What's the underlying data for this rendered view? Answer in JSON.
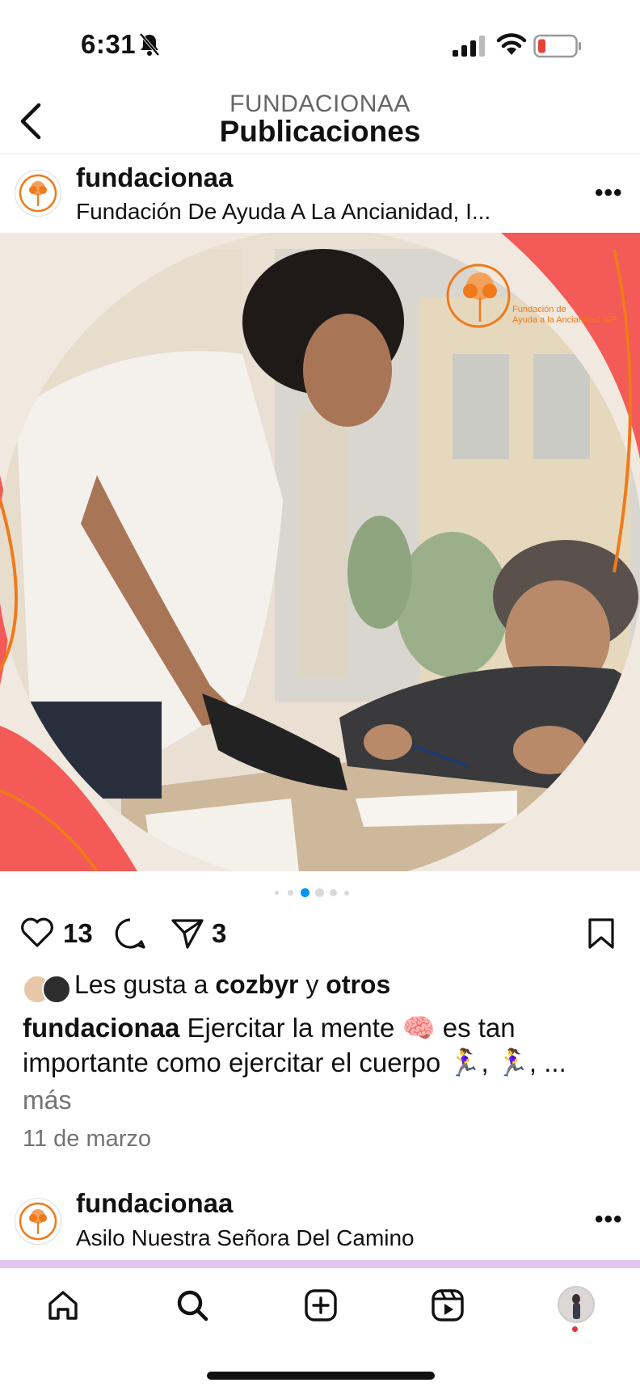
{
  "status_bar": {
    "time": "6:31",
    "icons": [
      "bell-slash-icon",
      "signal-icon",
      "wifi-icon",
      "battery-low-icon"
    ],
    "battery_color": "#e8413c"
  },
  "header": {
    "subtitle": "FUNDACIONAA",
    "title": "Publicaciones"
  },
  "post": {
    "username": "fundacionaa",
    "location": "Fundación De Ayuda A La Ancianidad, I...",
    "image_logo_line1": "Fundación de",
    "image_logo_line2": "Ayuda a la Ancianidad IAP",
    "carousel": {
      "total": 6,
      "active_index": 2
    },
    "likes_count": "13",
    "shares_count": "3",
    "likes_prefix": "Les gusta a",
    "likes_user": "cozbyr",
    "likes_conj": "y",
    "likes_others": "otros",
    "caption_user": "fundacionaa",
    "caption_text": "Ejercitar la mente 🧠 es tan importante como ejercitar el cuerpo 🏃‍♀️, 🏃‍♀️, ...",
    "more_label": "más",
    "date": "11 de marzo"
  },
  "next_post": {
    "username": "fundacionaa",
    "location": "Asilo Nuestra Señora Del Camino"
  },
  "tab_bar": {
    "items": [
      "home-icon",
      "search-icon",
      "create-icon",
      "reels-icon",
      "profile-avatar"
    ],
    "notification_dot_color": "#e8313c"
  },
  "colors": {
    "accent_blue": "#0095f6",
    "brand_orange": "#f07a1a",
    "brand_coral": "#f45a57"
  }
}
